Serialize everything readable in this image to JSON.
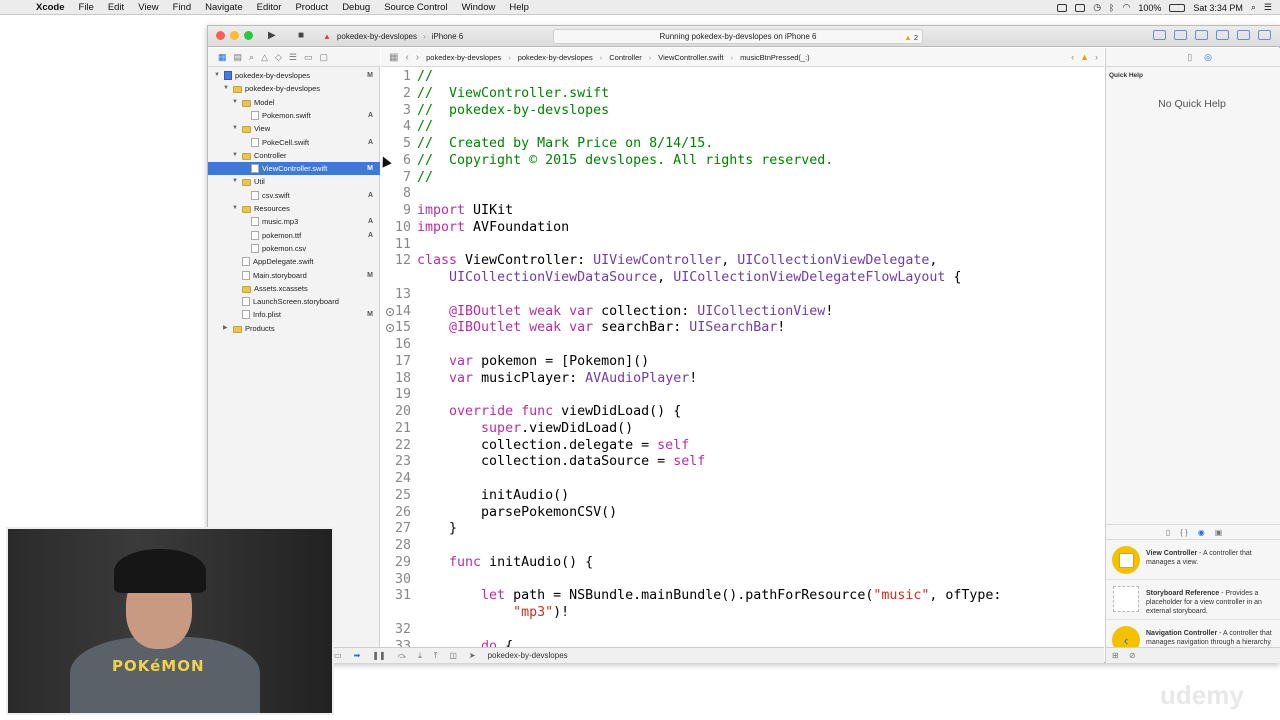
{
  "menubar": {
    "app_name": "Xcode",
    "items": [
      "File",
      "Edit",
      "View",
      "Find",
      "Navigate",
      "Editor",
      "Product",
      "Debug",
      "Source Control",
      "Window",
      "Help"
    ],
    "battery": "100%",
    "clock": "Sat 3:34 PM"
  },
  "toolbar": {
    "scheme_project": "pokedex-by-devslopes",
    "scheme_device": "iPhone 6",
    "activity_text": "Running pokedex-by-devslopes on iPhone 6",
    "warning_count": "2"
  },
  "navigator": {
    "rows": [
      {
        "label": "pokedex-by-devslopes",
        "level": 0,
        "kind": "proj",
        "status": "M",
        "disc": "▼"
      },
      {
        "label": "pokedex-by-devslopes",
        "level": 1,
        "kind": "folder",
        "status": "",
        "disc": "▼"
      },
      {
        "label": "Model",
        "level": 2,
        "kind": "folder",
        "status": "",
        "disc": "▼"
      },
      {
        "label": "Pokemon.swift",
        "level": 3,
        "kind": "swift",
        "status": "A",
        "disc": ""
      },
      {
        "label": "View",
        "level": 2,
        "kind": "folder",
        "status": "",
        "disc": "▼"
      },
      {
        "label": "PokeCell.swift",
        "level": 3,
        "kind": "swift",
        "status": "A",
        "disc": ""
      },
      {
        "label": "Controller",
        "level": 2,
        "kind": "folder",
        "status": "",
        "disc": "▼"
      },
      {
        "label": "ViewController.swift",
        "level": 3,
        "kind": "swift",
        "status": "M",
        "disc": "",
        "selected": true
      },
      {
        "label": "Util",
        "level": 2,
        "kind": "folder",
        "status": "",
        "disc": "▼"
      },
      {
        "label": "csv.swift",
        "level": 3,
        "kind": "swift",
        "status": "A",
        "disc": ""
      },
      {
        "label": "Resources",
        "level": 2,
        "kind": "folder",
        "status": "",
        "disc": "▼"
      },
      {
        "label": "music.mp3",
        "level": 3,
        "kind": "file",
        "status": "A",
        "disc": ""
      },
      {
        "label": "pokemon.ttf",
        "level": 3,
        "kind": "file",
        "status": "A",
        "disc": ""
      },
      {
        "label": "pokemon.csv",
        "level": 3,
        "kind": "file",
        "status": "",
        "disc": ""
      },
      {
        "label": "AppDelegate.swift",
        "level": 2,
        "kind": "swift",
        "status": "",
        "disc": ""
      },
      {
        "label": "Main.storyboard",
        "level": 2,
        "kind": "file",
        "status": "M",
        "disc": ""
      },
      {
        "label": "Assets.xcassets",
        "level": 2,
        "kind": "folder",
        "status": "",
        "disc": ""
      },
      {
        "label": "LaunchScreen.storyboard",
        "level": 2,
        "kind": "file",
        "status": "",
        "disc": ""
      },
      {
        "label": "Info.plist",
        "level": 2,
        "kind": "file",
        "status": "M",
        "disc": ""
      },
      {
        "label": "Products",
        "level": 1,
        "kind": "folder",
        "status": "",
        "disc": "▶"
      }
    ]
  },
  "jumpbar": {
    "crumbs": [
      "pokedex-by-devslopes",
      "pokedex-by-devslopes",
      "Controller",
      "ViewController.swift",
      "musicBtnPressed(_:)"
    ]
  },
  "editor": {
    "lines": [
      {
        "n": "1",
        "segs": [
          [
            "c",
            "//"
          ]
        ]
      },
      {
        "n": "2",
        "segs": [
          [
            "c",
            "//  ViewController.swift"
          ]
        ]
      },
      {
        "n": "3",
        "segs": [
          [
            "c",
            "//  pokedex-by-devslopes"
          ]
        ]
      },
      {
        "n": "4",
        "segs": [
          [
            "c",
            "//"
          ]
        ]
      },
      {
        "n": "5",
        "segs": [
          [
            "c",
            "//  Created by Mark Price on 8/14/15."
          ]
        ]
      },
      {
        "n": "6",
        "segs": [
          [
            "c",
            "//  Copyright © 2015 devslopes. All rights reserved."
          ]
        ]
      },
      {
        "n": "7",
        "segs": [
          [
            "c",
            "//"
          ]
        ]
      },
      {
        "n": "8",
        "segs": []
      },
      {
        "n": "9",
        "segs": [
          [
            "k",
            "import"
          ],
          [
            "p",
            " UIKit"
          ]
        ]
      },
      {
        "n": "10",
        "segs": [
          [
            "k",
            "import"
          ],
          [
            "p",
            " AVFoundation"
          ]
        ]
      },
      {
        "n": "11",
        "segs": []
      },
      {
        "n": "12",
        "segs": [
          [
            "k",
            "class"
          ],
          [
            "p",
            " ViewController: "
          ],
          [
            "t",
            "UIViewController"
          ],
          [
            "p",
            ", "
          ],
          [
            "t",
            "UICollectionViewDelegate"
          ],
          [
            "p",
            ","
          ]
        ]
      },
      {
        "n": "",
        "segs": [
          [
            "p",
            "    "
          ],
          [
            "t",
            "UICollectionViewDataSource"
          ],
          [
            "p",
            ", "
          ],
          [
            "t",
            "UICollectionViewDelegateFlowLayout"
          ],
          [
            "p",
            " {"
          ]
        ]
      },
      {
        "n": "13",
        "segs": []
      },
      {
        "n": "14",
        "bp": true,
        "segs": [
          [
            "p",
            "    "
          ],
          [
            "k",
            "@IBOutlet weak var"
          ],
          [
            "p",
            " collection: "
          ],
          [
            "t",
            "UICollectionView"
          ],
          [
            "p",
            "!"
          ]
        ]
      },
      {
        "n": "15",
        "bp": true,
        "segs": [
          [
            "p",
            "    "
          ],
          [
            "k",
            "@IBOutlet weak var"
          ],
          [
            "p",
            " searchBar: "
          ],
          [
            "t",
            "UISearchBar"
          ],
          [
            "p",
            "!"
          ]
        ]
      },
      {
        "n": "16",
        "segs": []
      },
      {
        "n": "17",
        "segs": [
          [
            "p",
            "    "
          ],
          [
            "k",
            "var"
          ],
          [
            "p",
            " pokemon = [Pokemon]()"
          ]
        ]
      },
      {
        "n": "18",
        "segs": [
          [
            "p",
            "    "
          ],
          [
            "k",
            "var"
          ],
          [
            "p",
            " musicPlayer: "
          ],
          [
            "t",
            "AVAudioPlayer"
          ],
          [
            "p",
            "!"
          ]
        ]
      },
      {
        "n": "19",
        "segs": []
      },
      {
        "n": "20",
        "segs": [
          [
            "p",
            "    "
          ],
          [
            "k",
            "override func"
          ],
          [
            "p",
            " viewDidLoad() {"
          ]
        ]
      },
      {
        "n": "21",
        "segs": [
          [
            "p",
            "        "
          ],
          [
            "k",
            "super"
          ],
          [
            "p",
            ".viewDidLoad()"
          ]
        ]
      },
      {
        "n": "22",
        "segs": [
          [
            "p",
            "        collection.delegate = "
          ],
          [
            "k",
            "self"
          ]
        ]
      },
      {
        "n": "23",
        "segs": [
          [
            "p",
            "        collection.dataSource = "
          ],
          [
            "k",
            "self"
          ]
        ]
      },
      {
        "n": "24",
        "segs": []
      },
      {
        "n": "25",
        "segs": [
          [
            "p",
            "        initAudio()"
          ]
        ]
      },
      {
        "n": "26",
        "segs": [
          [
            "p",
            "        parsePokemonCSV()"
          ]
        ]
      },
      {
        "n": "27",
        "segs": [
          [
            "p",
            "    }"
          ]
        ]
      },
      {
        "n": "28",
        "segs": []
      },
      {
        "n": "29",
        "segs": [
          [
            "p",
            "    "
          ],
          [
            "k",
            "func"
          ],
          [
            "p",
            " initAudio() {"
          ]
        ]
      },
      {
        "n": "30",
        "segs": []
      },
      {
        "n": "31",
        "segs": [
          [
            "p",
            "        "
          ],
          [
            "k",
            "let"
          ],
          [
            "p",
            " path = NSBundle.mainBundle().pathForResource("
          ],
          [
            "s",
            "\"music\""
          ],
          [
            "p",
            ", ofType:"
          ]
        ]
      },
      {
        "n": "",
        "segs": [
          [
            "p",
            "            "
          ],
          [
            "s",
            "\"mp3\""
          ],
          [
            "p",
            ")!"
          ]
        ]
      },
      {
        "n": "32",
        "segs": []
      },
      {
        "n": "33",
        "segs": [
          [
            "p",
            "        "
          ],
          [
            "k",
            "do"
          ],
          [
            "p",
            " {"
          ]
        ]
      }
    ]
  },
  "debugbar": {
    "target": "pokedex-by-devslopes"
  },
  "utilities": {
    "quick_help_title": "Quick Help",
    "quick_help_empty": "No Quick Help",
    "library": [
      {
        "title": "View Controller",
        "desc": " - A controller that manages a view.",
        "icon": "sq"
      },
      {
        "title": "Storyboard Reference",
        "desc": " - Provides a placeholder for a view controller in an external storyboard.",
        "icon": "dash"
      },
      {
        "title": "Navigation Controller",
        "desc": " - A controller that manages navigation through a hierarchy of views.",
        "icon": "chev"
      }
    ]
  },
  "webcam": {
    "shirt_text": "POKéMON"
  },
  "watermark": "udemy",
  "colors": {
    "accent": "#3e79d8",
    "comment": "#008400",
    "keyword": "#ba2da2",
    "type": "#703daa",
    "string": "#d12f1b"
  }
}
